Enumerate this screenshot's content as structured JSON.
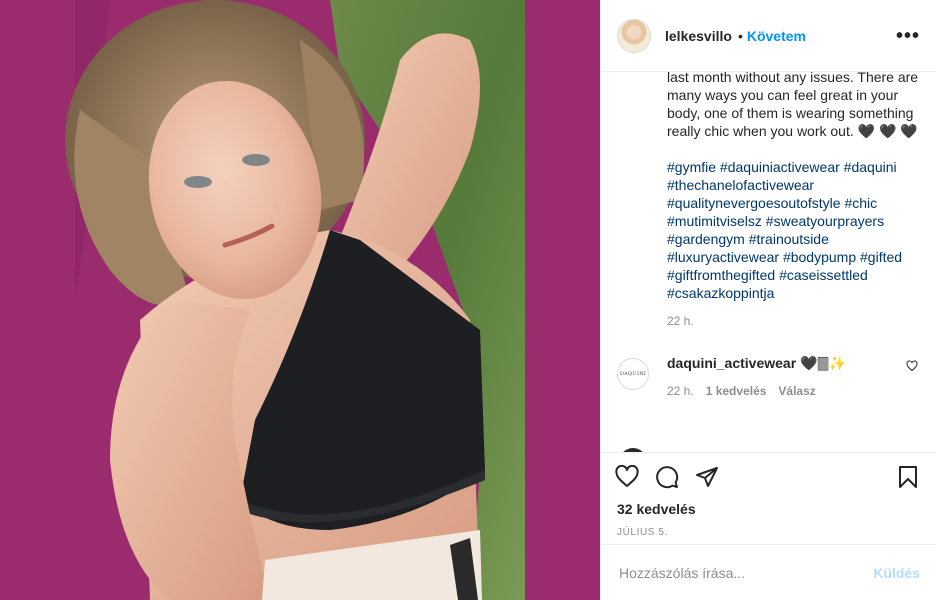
{
  "header": {
    "username": "lelkesvillo",
    "separator": "•",
    "follow_label": "Követem",
    "more_label": "•••"
  },
  "caption": {
    "text": "last month without any issues. There are many ways you can feel great in your body, one of them is wearing something really chic when you work out. 🖤 🖤 🖤",
    "hashtags": [
      "#gymfie",
      "#daquiniactivewear",
      "#daquini",
      "#thechanelofactivewear",
      "#qualitynevergoesoutofstyle",
      "#chic",
      "#mutimitviselsz",
      "#sweatyourprayers",
      "#gardengym",
      "#trainoutside",
      "#luxuryactivewear",
      "#bodypump",
      "#gifted",
      "#giftfromthegifted",
      "#caseissettled",
      "#csakazkoppintja"
    ],
    "time": "22 h."
  },
  "comments": [
    {
      "avatar_text": "DAQUINI",
      "username": "daquini_activewear",
      "text": "🖤🀫✨",
      "time": "22 h.",
      "likes": "1 kedvelés",
      "reply": "Válasz"
    }
  ],
  "actions": {
    "likes": "32 kedvelés",
    "date": "július 5."
  },
  "comment_box": {
    "placeholder": "Hozzászólás írása...",
    "post_label": "Küldés"
  },
  "colors": {
    "link_blue": "#0095f6",
    "hashtag": "#00376b",
    "muted": "#8e8e8e",
    "mat_magenta": "#9a2c6e",
    "disabled_blue": "#b2dffc"
  },
  "icons": [
    "more-icon",
    "heart-icon",
    "comment-icon",
    "share-icon",
    "bookmark-icon",
    "small-heart-icon"
  ]
}
